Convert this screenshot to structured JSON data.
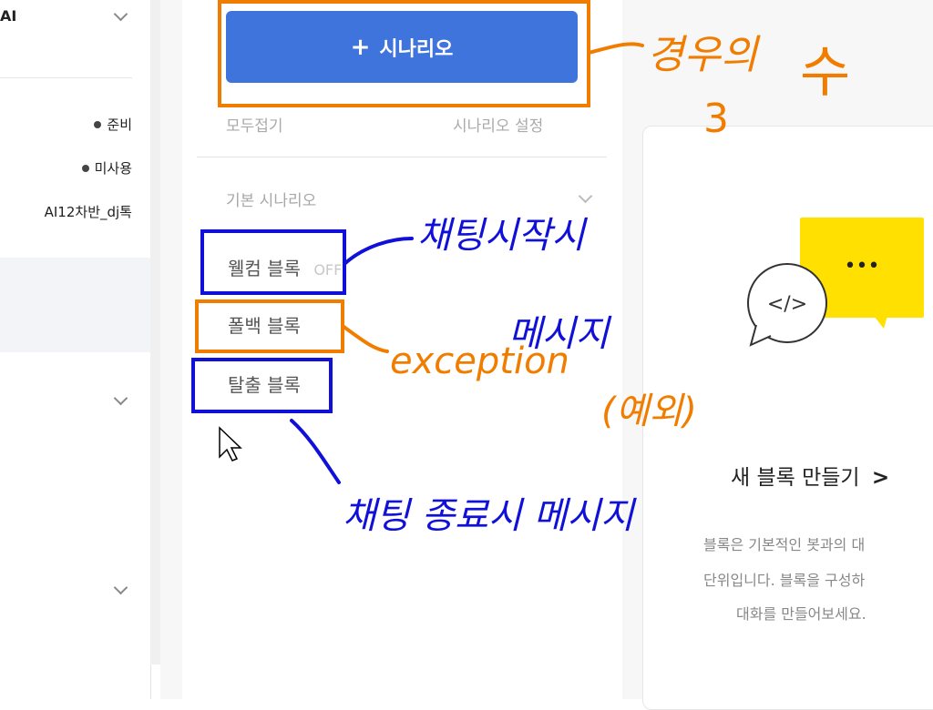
{
  "left": {
    "title": "AI",
    "statuses": [
      {
        "label": "준비"
      },
      {
        "label": "미사용"
      }
    ],
    "bot_name": "AI12차반_dj톡"
  },
  "scenario": {
    "add_button": "시나리오",
    "collapse_all": "모두접기",
    "settings": "시나리오 설정",
    "section_title": "기본 시나리오",
    "blocks": [
      {
        "label": "웰컴 블록",
        "extra": "OFF"
      },
      {
        "label": "폴백 블록"
      },
      {
        "label": "탈출 블록"
      }
    ]
  },
  "canvas": {
    "card_title": "새 블록 만들기",
    "card_desc_lines": [
      "블록은 기본적인 봇과의 대",
      "단위입니다. 블록을 구성하",
      "대화를 만들어보세요."
    ],
    "bubble_dots": "•••",
    "code_symbol": "</>"
  },
  "annotations": {
    "scenario_note_line1": "경우의",
    "scenario_note_line2": "수",
    "scenario_note_number": "3",
    "welcome_note_line1": "채팅시작시",
    "welcome_note_line2": "메시지",
    "fallback_note_line1": "exception",
    "fallback_note_line2": "(예외)",
    "exit_note": "채팅 종료시 메시지",
    "orange": "#f07d00",
    "blue": "#1010d8"
  },
  "colors": {
    "primary_button": "#3f74dc",
    "speech_bubble": "#ffe000"
  }
}
